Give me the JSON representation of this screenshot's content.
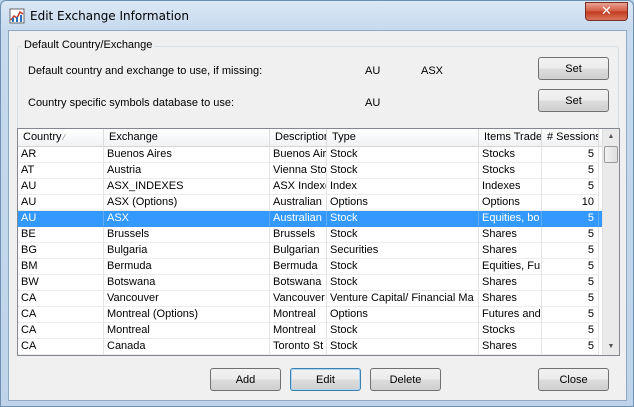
{
  "window": {
    "title": "Edit Exchange Information",
    "app_icon": "chart-icon",
    "close_glyph": "✕"
  },
  "defaults": {
    "group_title": "Default Country/Exchange",
    "row1_label": "Default country and exchange to use, if missing:",
    "row1_country": "AU",
    "row1_exchange": "ASX",
    "row1_button": "Set",
    "row2_label": "Country specific symbols database to use:",
    "row2_country": "AU",
    "row2_button": "Set"
  },
  "table": {
    "columns": [
      "Country",
      "Exchange",
      "Description",
      "Type",
      "Items Traded",
      "# Sessions"
    ],
    "sorted_column": "Country",
    "selected_row_index": 4,
    "rows": [
      [
        "AR",
        "Buenos Aires",
        "Buenos Aires",
        "Stock",
        "Stocks",
        "5"
      ],
      [
        "AT",
        "Austria",
        "Vienna Stock",
        "Stock",
        "Stocks",
        "5"
      ],
      [
        "AU",
        "ASX_INDEXES",
        "ASX Indexes",
        "Index",
        "Indexes",
        "5"
      ],
      [
        "AU",
        "ASX (Options)",
        "Australian",
        "Options",
        "Options",
        "10"
      ],
      [
        "AU",
        "ASX",
        "Australian",
        "Stock",
        "Equities, bo",
        "5"
      ],
      [
        "BE",
        "Brussels",
        "Brussels",
        "Stock",
        "Shares",
        "5"
      ],
      [
        "BG",
        "Bulgaria",
        "Bulgarian",
        "Securities",
        "Shares",
        "5"
      ],
      [
        "BM",
        "Bermuda",
        "Bermuda",
        "Stock",
        "Equities, Fu",
        "5"
      ],
      [
        "BW",
        "Botswana",
        "Botswana",
        "Stock",
        "Shares",
        "5"
      ],
      [
        "CA",
        "Vancouver",
        "Vancouver",
        "Venture Capital/ Financial Ma",
        "Shares",
        "5"
      ],
      [
        "CA",
        "Montreal (Options)",
        "Montreal",
        "Options",
        "Futures and",
        "5"
      ],
      [
        "CA",
        "Montreal",
        "Montreal",
        "Stock",
        "Stocks",
        "5"
      ],
      [
        "CA",
        "Canada",
        "Toronto St",
        "Stock",
        "Shares",
        "5"
      ]
    ]
  },
  "buttons": {
    "add": "Add",
    "edit": "Edit",
    "delete": "Delete",
    "close": "Close"
  },
  "colors": {
    "selection": "#3399ff",
    "client_bg": "#f0f0f0",
    "frame": "#bfd3ea"
  }
}
